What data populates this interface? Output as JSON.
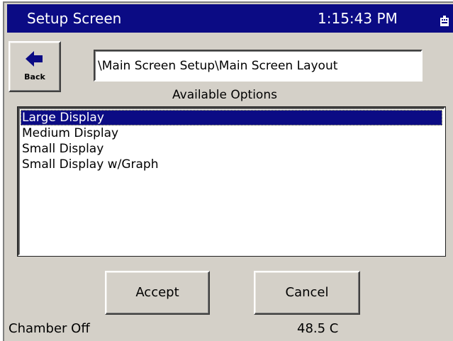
{
  "titlebar": {
    "title": "Setup Screen",
    "clock": "1:15:43 PM",
    "icon": "keyboard-icon"
  },
  "back_button": {
    "label": "Back",
    "icon": "left-arrow-icon"
  },
  "path_field": {
    "value": "\\Main Screen Setup\\Main Screen Layout"
  },
  "options": {
    "heading": "Available Options",
    "items": [
      "Large Display",
      "Medium Display",
      "Small Display",
      "Small Display w/Graph"
    ],
    "selected_index": 0
  },
  "actions": {
    "accept_label": "Accept",
    "cancel_label": "Cancel"
  },
  "status": {
    "chamber": "Chamber Off",
    "temperature": "48.5 C"
  },
  "colors": {
    "titlebar_bg": "#0b0b84",
    "selection_bg": "#0b0b84",
    "panel_bg": "#d4d0c8"
  }
}
